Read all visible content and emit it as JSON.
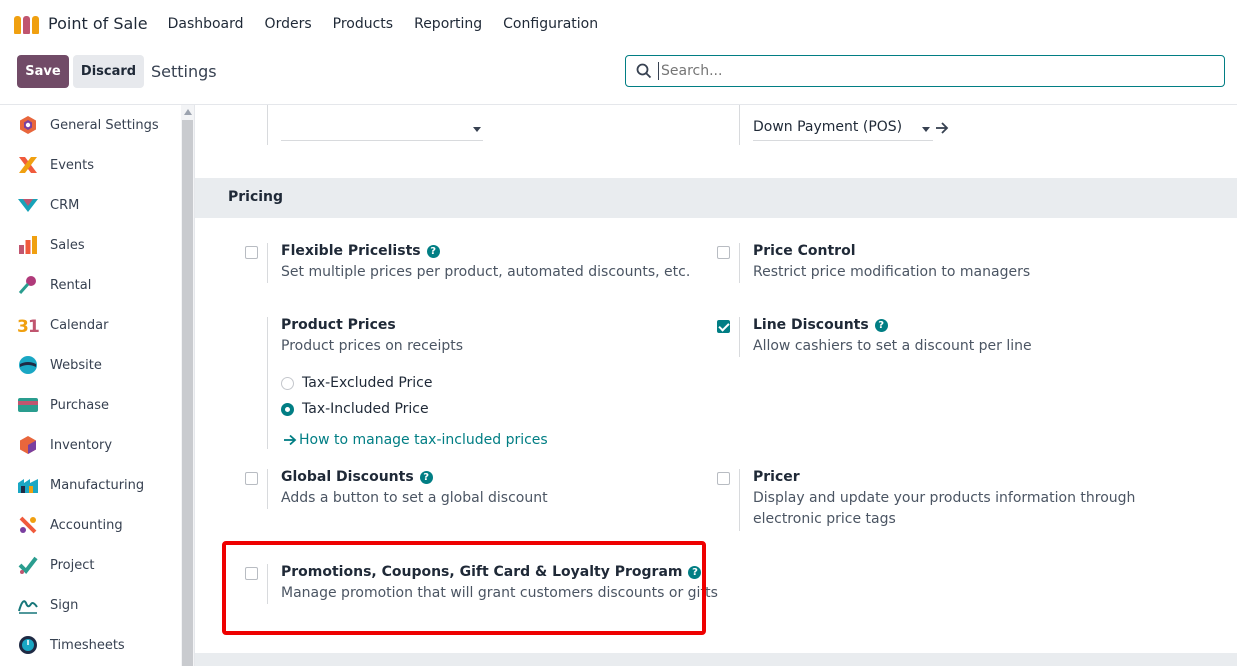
{
  "navbar": {
    "app_name": "Point of Sale",
    "menu": [
      "Dashboard",
      "Orders",
      "Products",
      "Reporting",
      "Configuration"
    ]
  },
  "control": {
    "save_label": "Save",
    "discard_label": "Discard",
    "title": "Settings",
    "search_placeholder": "Search..."
  },
  "sidebar": {
    "items": [
      {
        "label": "General Settings",
        "icon": "general-settings-icon",
        "color": "#e8663c"
      },
      {
        "label": "Events",
        "icon": "events-icon",
        "color": "#f05a3c"
      },
      {
        "label": "CRM",
        "icon": "crm-icon",
        "color": "#17a2b8"
      },
      {
        "label": "Sales",
        "icon": "sales-icon",
        "color": "#f0a010"
      },
      {
        "label": "Rental",
        "icon": "rental-icon",
        "color": "#b03a7a"
      },
      {
        "label": "Calendar",
        "icon": "calendar-icon",
        "color": "#f0a010"
      },
      {
        "label": "Website",
        "icon": "website-icon",
        "color": "#1aa7c4"
      },
      {
        "label": "Purchase",
        "icon": "purchase-icon",
        "color": "#2a9d8f"
      },
      {
        "label": "Inventory",
        "icon": "inventory-icon",
        "color": "#e8663c"
      },
      {
        "label": "Manufacturing",
        "icon": "manufacturing-icon",
        "color": "#1aa7c4"
      },
      {
        "label": "Accounting",
        "icon": "accounting-icon",
        "color": "#f05a3c"
      },
      {
        "label": "Project",
        "icon": "project-icon",
        "color": "#2a9d8f"
      },
      {
        "label": "Sign",
        "icon": "sign-icon",
        "color": "#17777a"
      },
      {
        "label": "Timesheets",
        "icon": "timesheets-icon",
        "color": "#1f2a44"
      }
    ]
  },
  "top_fields": {
    "left_value": "",
    "right_value": "Down Payment (POS)"
  },
  "section": {
    "title": "Pricing"
  },
  "settings": {
    "flexible_pricelists": {
      "title": "Flexible Pricelists",
      "desc": "Set multiple prices per product, automated discounts, etc.",
      "checked": false
    },
    "price_control": {
      "title": "Price Control",
      "desc": "Restrict price modification to managers",
      "checked": false
    },
    "product_prices": {
      "title": "Product Prices",
      "desc": "Product prices on receipts",
      "options": [
        "Tax-Excluded Price",
        "Tax-Included Price"
      ],
      "selected": "Tax-Included Price",
      "link": "How to manage tax-included prices"
    },
    "line_discounts": {
      "title": "Line Discounts",
      "desc": "Allow cashiers to set a discount per line",
      "checked": true
    },
    "global_discounts": {
      "title": "Global Discounts",
      "desc": "Adds a button to set a global discount",
      "checked": false
    },
    "pricer": {
      "title": "Pricer",
      "desc_line1": "Display and update your products information through",
      "desc_line2": "electronic price tags",
      "checked": false
    },
    "promotions": {
      "title": "Promotions, Coupons, Gift Card & Loyalty Program",
      "desc": "Manage promotion that will grant customers discounts or gifts",
      "checked": false
    }
  },
  "colors": {
    "brand": "#714b67",
    "accent": "#017e84",
    "highlight": "#ee0000"
  }
}
